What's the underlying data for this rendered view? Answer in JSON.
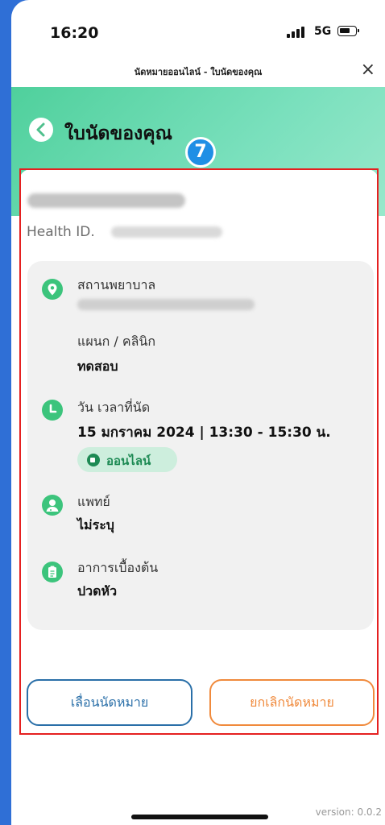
{
  "status": {
    "time": "16:20",
    "network": "5G"
  },
  "webbar": {
    "title": "นัดหมายออนไลน์ - ใบนัดของคุณ",
    "close": "×"
  },
  "header": {
    "title": "ใบนัดของคุณ"
  },
  "badge": "7",
  "patient": {
    "health_id_label": "Health ID."
  },
  "appointment": {
    "hospital_label": "สถานพยาบาล",
    "department_label": "แผนก / คลินิก",
    "department_value": "ทดสอบ",
    "datetime_label": "วัน เวลาที่นัด",
    "datetime_value": "15 มกราคม 2024 | 13:30 - 15:30 น.",
    "online_chip": "ออนไลน์",
    "doctor_label": "แพทย์",
    "doctor_value": "ไม่ระบุ",
    "symptom_label": "อาการเบื้องต้น",
    "symptom_value": "ปวดหัว"
  },
  "buttons": {
    "reschedule": "เลื่อนนัดหมาย",
    "cancel": "ยกเลิกนัดหมาย"
  },
  "version": "version: 0.0.2",
  "colors": {
    "accent_green": "#3cc47c",
    "reschedule": "#2a6fa8",
    "cancel": "#f08a3c",
    "highlight": "#e52020",
    "badge": "#1f8fe5"
  },
  "icons": [
    "location-pin-icon",
    "clock-icon",
    "doctor-icon",
    "clipboard-icon",
    "video-icon",
    "back-chevron-icon",
    "close-icon"
  ]
}
